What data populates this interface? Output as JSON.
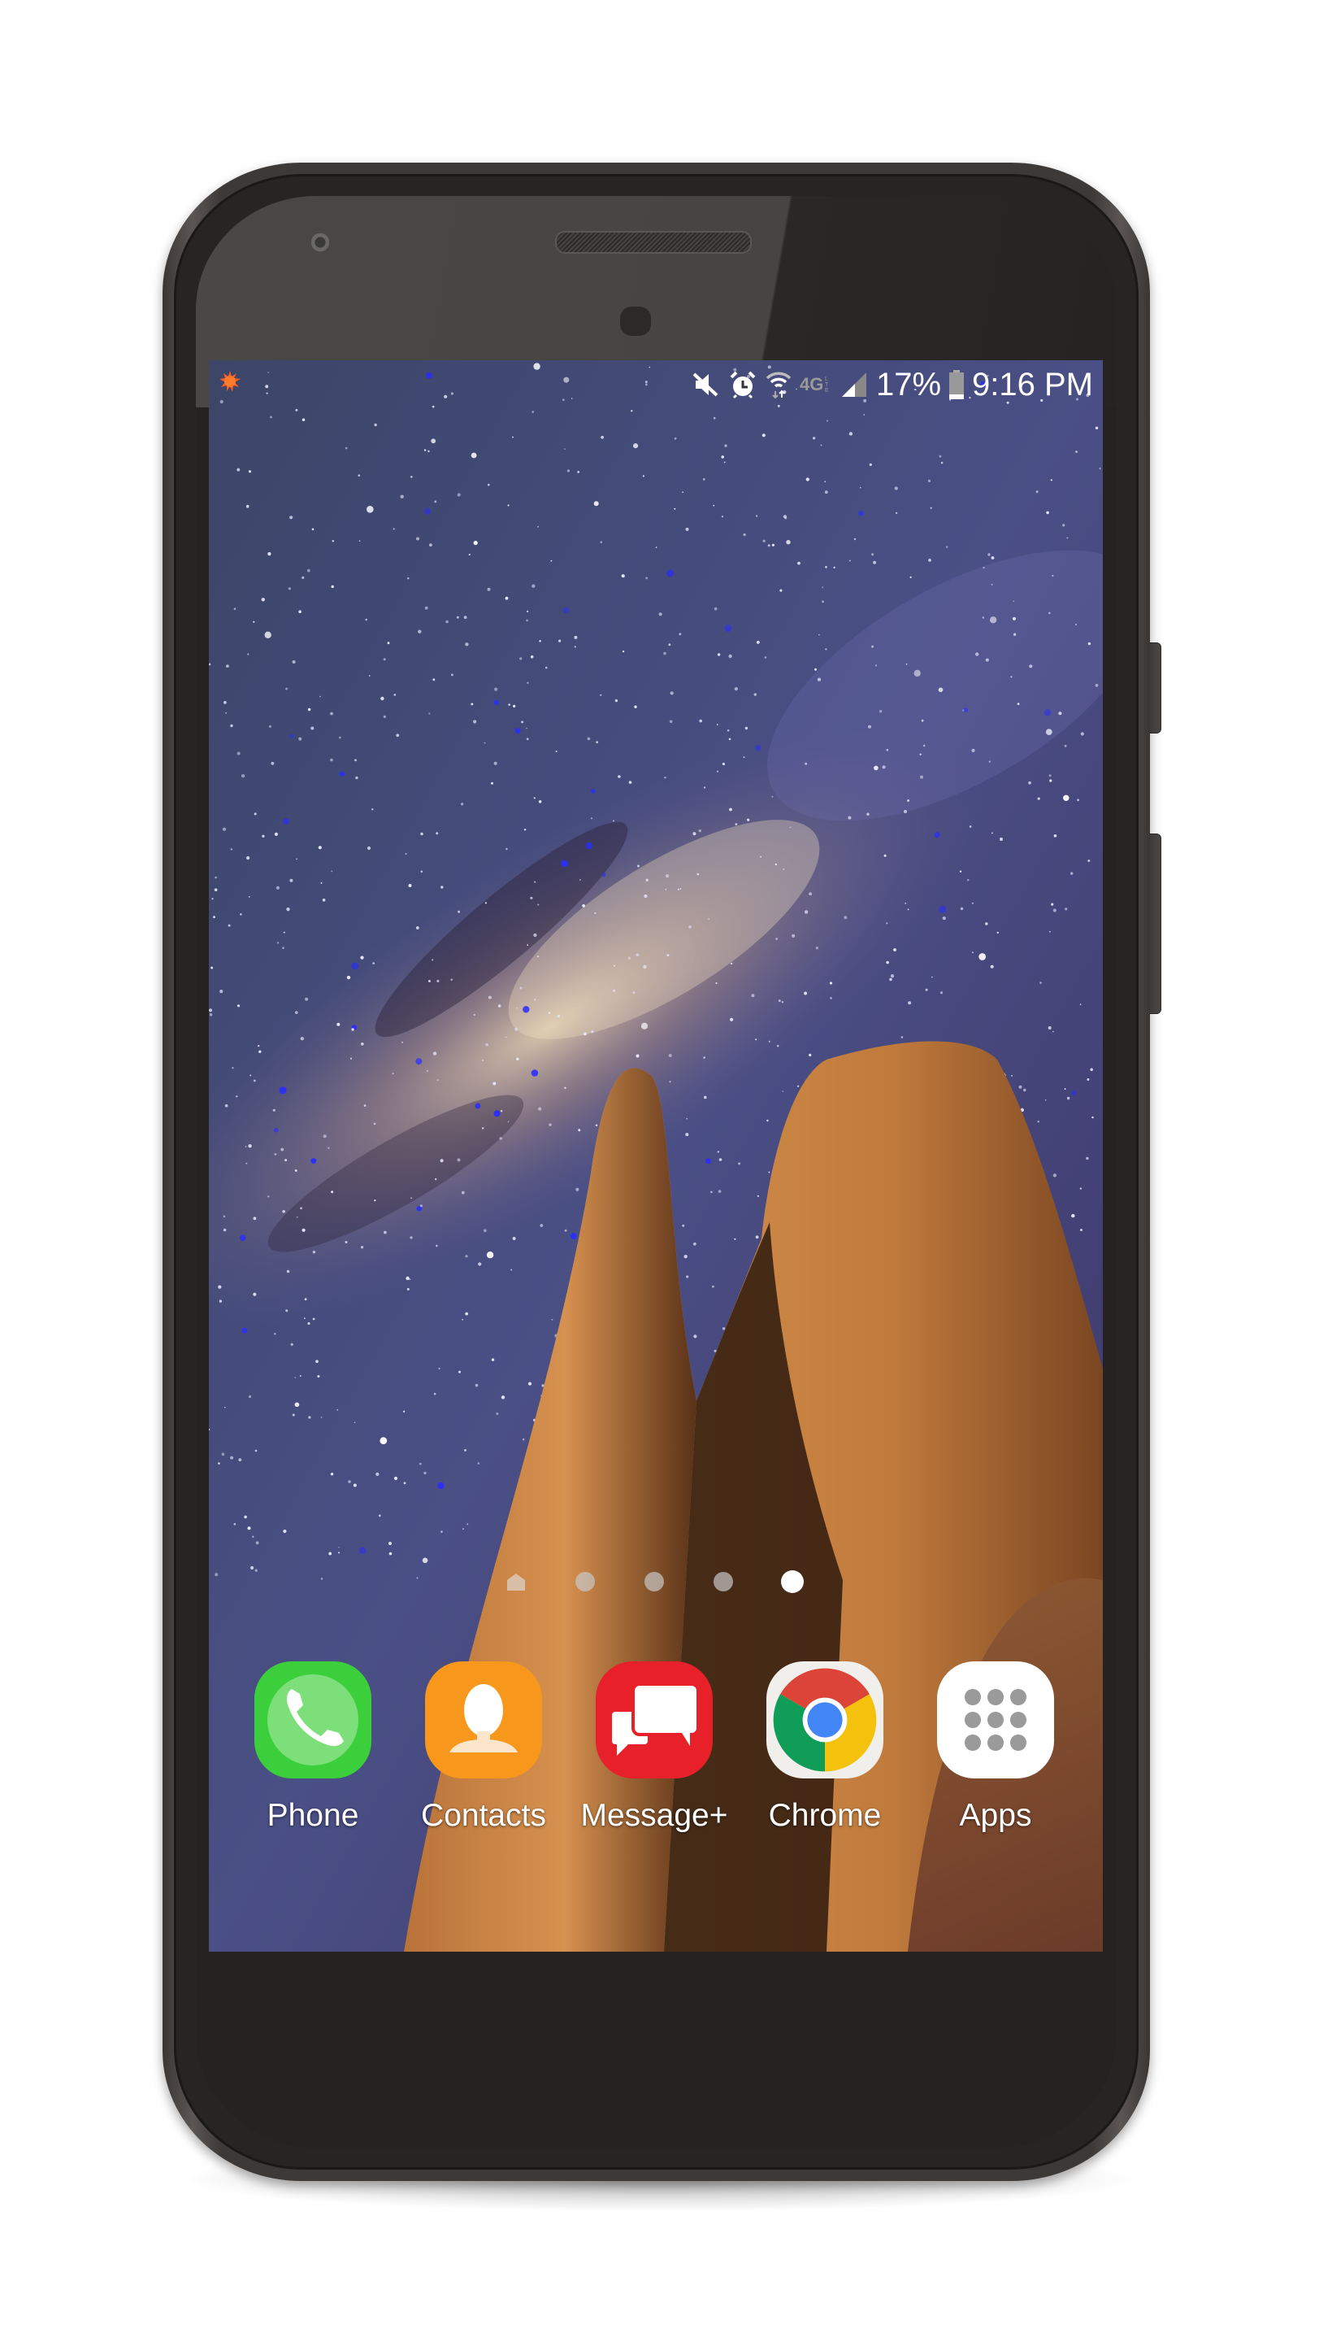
{
  "device": {
    "model": "Android phone",
    "frame_color": "#3d3937"
  },
  "status_bar": {
    "left_icons": [
      {
        "name": "notification-sun-icon",
        "color": "#ff5a1f"
      }
    ],
    "right_icons": [
      {
        "name": "vibrate-mute-icon"
      },
      {
        "name": "alarm-icon"
      },
      {
        "name": "wifi-icon"
      },
      {
        "name": "4g-lte-icon",
        "text": "4G LTE"
      },
      {
        "name": "signal-icon"
      }
    ],
    "battery_percent": "17%",
    "battery_level": 0.17,
    "time": "9:16 PM"
  },
  "wallpaper": {
    "description": "Milky Way night sky over sandstone rock pinnacles"
  },
  "page_indicator": {
    "total": 5,
    "active_index": 4,
    "first_is_home": true
  },
  "dock": {
    "apps": [
      {
        "id": "phone",
        "label": "Phone",
        "color": "#3ccf3c"
      },
      {
        "id": "contacts",
        "label": "Contacts",
        "color": "#f7981d"
      },
      {
        "id": "messages",
        "label": "Message+",
        "color": "#e8202a"
      },
      {
        "id": "chrome",
        "label": "Chrome",
        "color": "#f1efec"
      },
      {
        "id": "apps",
        "label": "Apps",
        "color": "#ffffff"
      }
    ]
  }
}
